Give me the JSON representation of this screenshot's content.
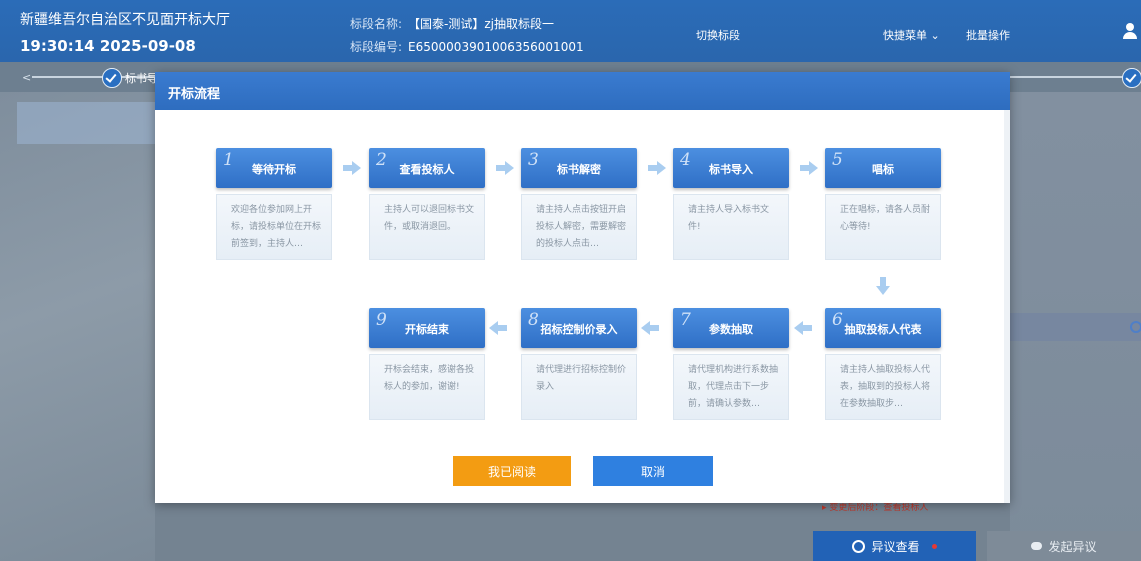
{
  "header": {
    "hall_title": "新疆维吾尔自治区不见面开标大厅",
    "clock": "19:30:14 2025-09-08",
    "project_name_label": "标段名称:",
    "project_name": "【国泰-测试】zj抽取标段一",
    "project_code_label": "标段编号:",
    "project_code": "E6500003901006356001001",
    "switch_section": "切换标段",
    "quick_menu": "快捷菜单 ⌄",
    "batch_ops": "批量操作",
    "user_icon": "user-icon"
  },
  "stepbar": {
    "first_step_label": "标书导入"
  },
  "modal": {
    "title": "开标流程",
    "steps": [
      {
        "num": "1",
        "title": "等待开标",
        "desc": "欢迎各位参加网上开标，请投标单位在开标前签到，主持人…"
      },
      {
        "num": "2",
        "title": "查看投标人",
        "desc": "主持人可以退回标书文件，或取消退回。"
      },
      {
        "num": "3",
        "title": "标书解密",
        "desc": "请主持人点击按钮开启投标人解密，需要解密的投标人点击…"
      },
      {
        "num": "4",
        "title": "标书导入",
        "desc": "请主持人导入标书文件!"
      },
      {
        "num": "5",
        "title": "唱标",
        "desc": "正在唱标，请各人员耐心等待!"
      },
      {
        "num": "6",
        "title": "抽取投标人代表",
        "desc": "请主持人抽取投标人代表，抽取到的投标人将在参数抽取步…"
      },
      {
        "num": "7",
        "title": "参数抽取",
        "desc": "请代理机构进行系数抽取，代理点击下一步前，请确认参数…"
      },
      {
        "num": "8",
        "title": "招标控制价录入",
        "desc": "请代理进行招标控制价录入"
      },
      {
        "num": "9",
        "title": "开标结束",
        "desc": "开标会结束，感谢各投标人的参加，谢谢!"
      }
    ],
    "read_button": "我已阅读",
    "cancel_button": "取消"
  },
  "sidebar_right": {
    "change_note": "▸ 变更后阶段：查看投标人",
    "objection_view": "异议查看",
    "raise_objection": "发起异议"
  },
  "colors": {
    "header_blue": "#2b6cb8",
    "step_blue": "#2f6fc6",
    "read_orange": "#f39c12",
    "cancel_blue": "#2f80e0"
  }
}
